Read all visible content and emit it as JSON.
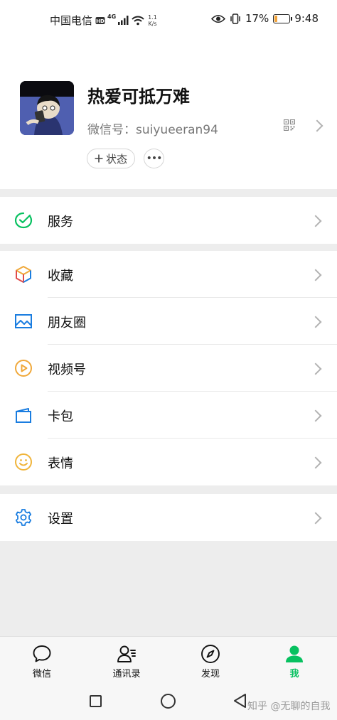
{
  "status_bar": {
    "carrier": "中国电信",
    "network": "4G",
    "speed_value": "1.1",
    "speed_unit": "K/s",
    "battery": "17%",
    "battery_level": 0.17,
    "time": "9:48"
  },
  "profile": {
    "nickname": "热爱可抵万难",
    "wechat_id": "微信号：suiyueeran94",
    "status_button": "状态",
    "more_button": "•••"
  },
  "menu": {
    "service": "服务",
    "favorites": "收藏",
    "moments": "朋友圈",
    "channels": "视频号",
    "cards": "卡包",
    "stickers": "表情",
    "settings": "设置"
  },
  "tabs": [
    {
      "label": "微信",
      "icon": "chat-bubble-icon"
    },
    {
      "label": "通讯录",
      "icon": "contacts-icon"
    },
    {
      "label": "发现",
      "icon": "compass-icon"
    },
    {
      "label": "我",
      "icon": "person-icon"
    }
  ],
  "colors": {
    "accent": "#07c160",
    "service_icon": "#07c160",
    "moments_icon": "#1a7de0",
    "channels_icon": "#f0a83a",
    "cards_icon": "#1a7de0",
    "stickers_icon": "#f0b43a",
    "settings_icon": "#1a7de0"
  },
  "watermark": "知乎 @无聊的自我"
}
